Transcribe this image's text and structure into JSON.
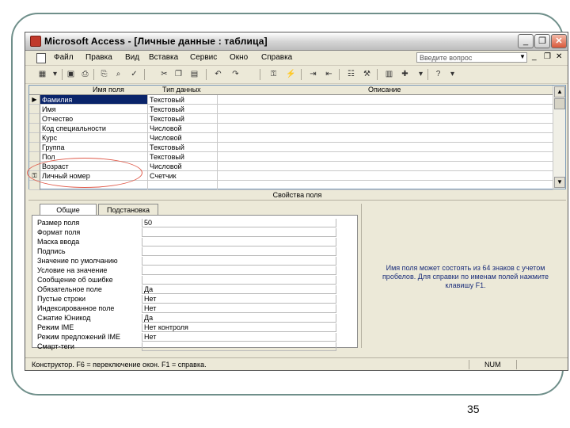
{
  "window": {
    "title": "Microsoft Access - [Личные данные : таблица]",
    "buttons": {
      "minimize": "_",
      "restore": "❐",
      "close": "✕"
    }
  },
  "menu": {
    "items": [
      "Файл",
      "Правка",
      "Вид",
      "Вставка",
      "Сервис",
      "Окно",
      "Справка"
    ],
    "help_placeholder": "Введите вопрос",
    "mdi_minimize": "_",
    "mdi_restore": "❐",
    "mdi_close": "✕"
  },
  "toolbar": {
    "icons": [
      "view-icon",
      "dropdown-icon",
      "save-icon",
      "print-preview-icon",
      "print-icon",
      "search-icon",
      "spelling-icon",
      "cut-icon",
      "copy-icon",
      "paste-icon",
      "undo-icon",
      "redo-icon",
      "key-icon",
      "indexes-icon",
      "insert-rows-icon",
      "delete-rows-icon",
      "properties-icon",
      "build-icon",
      "database-window-icon",
      "new-object-icon",
      "help-icon"
    ]
  },
  "table": {
    "columns": [
      "Имя поля",
      "Тип данных",
      "Описание"
    ],
    "rows": [
      {
        "marker": "▶",
        "name": "Фамилия",
        "type": "Текстовый",
        "desc": ""
      },
      {
        "marker": "",
        "name": "Имя",
        "type": "Текстовый",
        "desc": ""
      },
      {
        "marker": "",
        "name": "Отчество",
        "type": "Текстовый",
        "desc": ""
      },
      {
        "marker": "",
        "name": "Код специальности",
        "type": "Числовой",
        "desc": ""
      },
      {
        "marker": "",
        "name": "Курс",
        "type": "Числовой",
        "desc": ""
      },
      {
        "marker": "",
        "name": "Группа",
        "type": "Текстовый",
        "desc": ""
      },
      {
        "marker": "",
        "name": "Пол",
        "type": "Текстовый",
        "desc": ""
      },
      {
        "marker": "",
        "name": "Возраст",
        "type": "Числовой",
        "desc": ""
      },
      {
        "marker": "⚿",
        "name": "Личный номер",
        "type": "Счетчик",
        "desc": ""
      },
      {
        "marker": "",
        "name": "",
        "type": "",
        "desc": ""
      }
    ]
  },
  "properties": {
    "header": "Свойства поля",
    "tabs": [
      "Общие",
      "Подстановка"
    ],
    "rows": [
      {
        "label": "Размер поля",
        "value": "50"
      },
      {
        "label": "Формат поля",
        "value": ""
      },
      {
        "label": "Маска ввода",
        "value": ""
      },
      {
        "label": "Подпись",
        "value": ""
      },
      {
        "label": "Значение по умолчанию",
        "value": ""
      },
      {
        "label": "Условие на значение",
        "value": ""
      },
      {
        "label": "Сообщение об ошибке",
        "value": ""
      },
      {
        "label": "Обязательное поле",
        "value": "Да"
      },
      {
        "label": "Пустые строки",
        "value": "Нет"
      },
      {
        "label": "Индексированное поле",
        "value": "Нет"
      },
      {
        "label": "Сжатие Юникод",
        "value": "Да"
      },
      {
        "label": "Режим IME",
        "value": "Нет контроля"
      },
      {
        "label": "Режим предложений IME",
        "value": "Нет"
      },
      {
        "label": "Смарт-теги",
        "value": ""
      }
    ],
    "hint": "Имя поля может состоять из 64 знаков с учетом пробелов. Для справки по именам полей нажмите клавишу F1."
  },
  "status": {
    "text": "Конструктор. F6 = переключение окон. F1 = справка.",
    "num": "NUM"
  },
  "slide": {
    "page_number": "35"
  },
  "colors": {
    "selection": "#0a246a",
    "annotation": "#e05a4a",
    "frame": "#6f8f8a"
  }
}
